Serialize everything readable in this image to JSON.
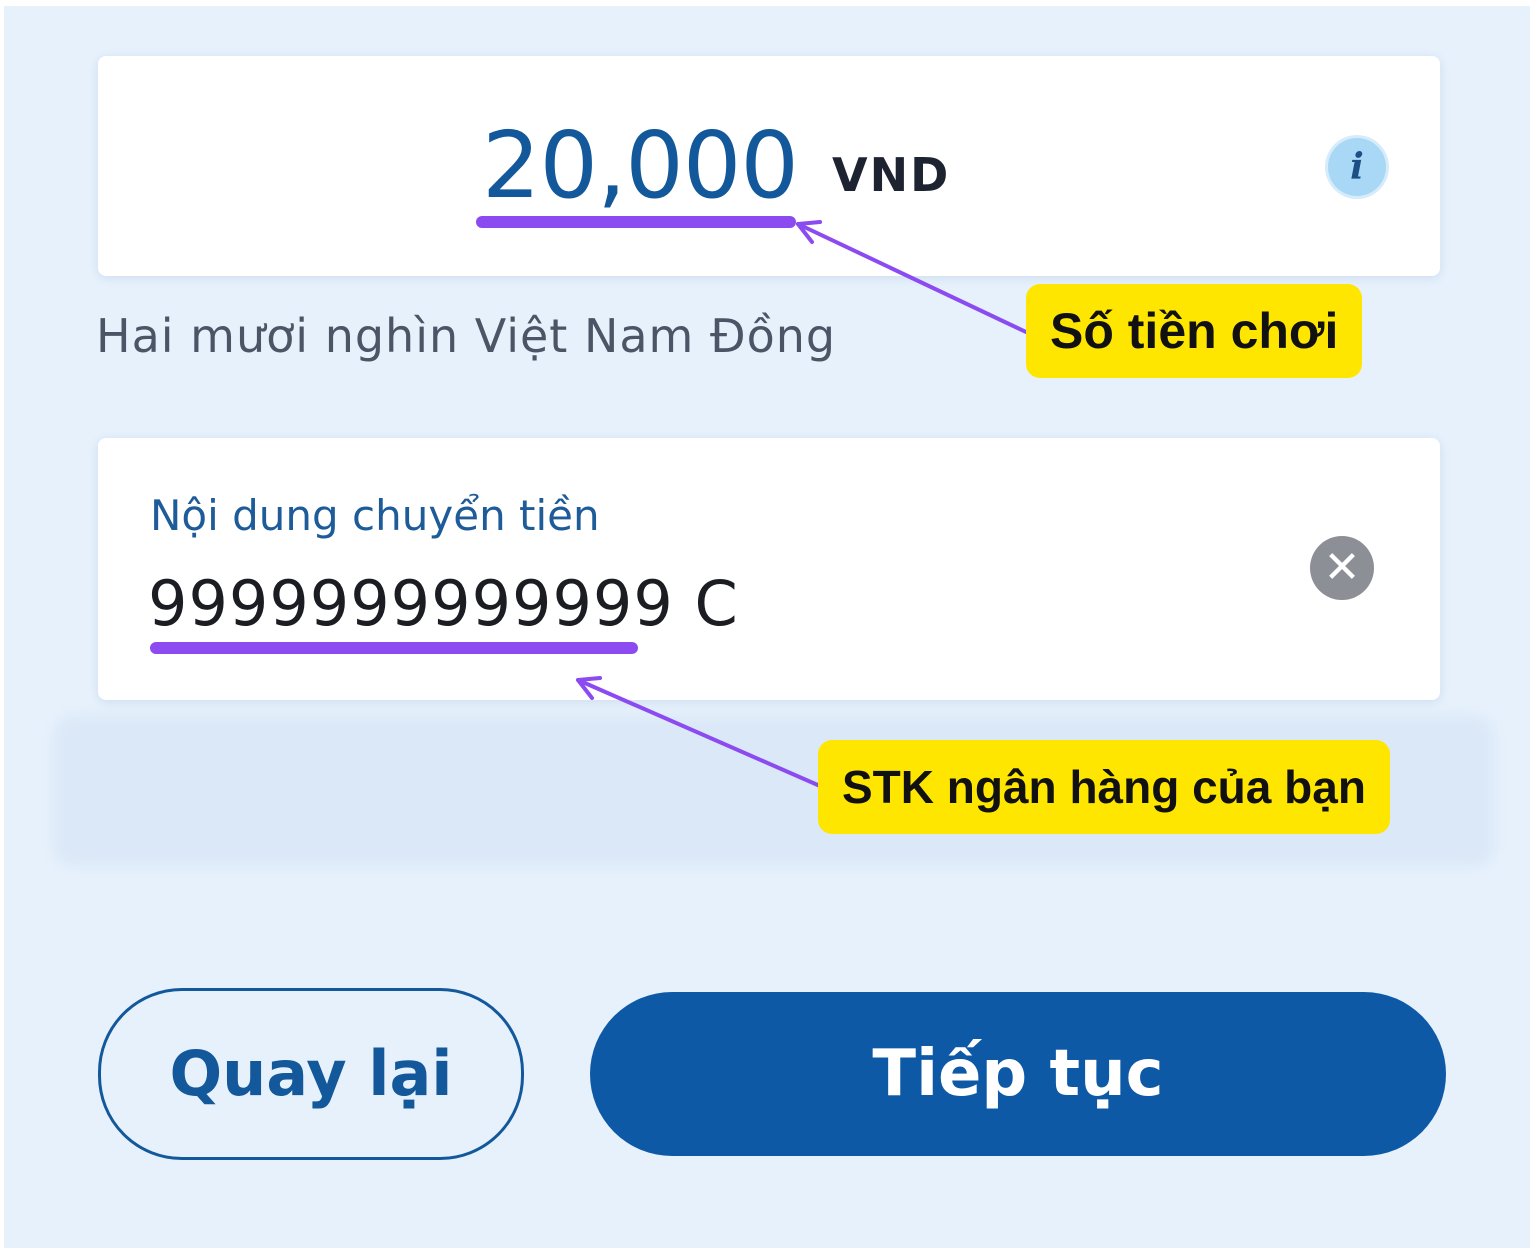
{
  "amount": {
    "value": "20,000",
    "currency": "VND",
    "info_icon": "info-icon",
    "words": "Hai mươi nghìn Việt Nam Đồng"
  },
  "transfer_content": {
    "label": "Nội dung chuyển tiền",
    "value": "9999999999999 C",
    "clear_icon": "clear-icon"
  },
  "annotations": {
    "amount_callout": "Số tiền chơi",
    "account_callout": "STK ngân hàng của bạn",
    "highlight_color": "#ffe600",
    "arrow_color": "#8b4bf0"
  },
  "actions": {
    "back_label": "Quay lại",
    "continue_label": "Tiếp tục"
  },
  "colors": {
    "brand_blue": "#0d59a6",
    "background": "#e6f1fc"
  }
}
